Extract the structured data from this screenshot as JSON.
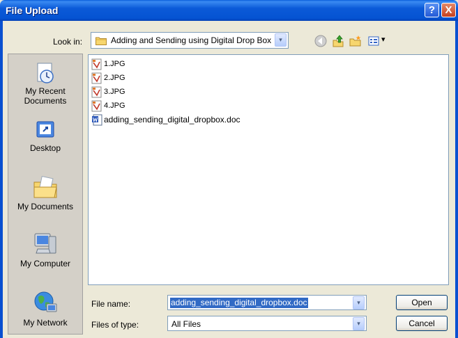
{
  "window": {
    "title": "File Upload",
    "help_label": "?",
    "close_label": "X"
  },
  "lookin": {
    "label": "Look in:",
    "value": "Adding and Sending using Digital Drop Box",
    "dropdown_glyph": "▾"
  },
  "toolbar": {
    "icons": [
      "back-icon",
      "up-one-level-icon",
      "create-new-folder-icon",
      "view-menu-icon"
    ],
    "view_arrow": "▾"
  },
  "places": [
    {
      "label": "My Recent Documents",
      "line1": "My Recent",
      "line2": "Documents",
      "icon": "my-recent-documents-icon"
    },
    {
      "label": "Desktop",
      "icon": "desktop-icon"
    },
    {
      "label": "My Documents",
      "icon": "my-documents-icon"
    },
    {
      "label": "My Computer",
      "icon": "my-computer-icon"
    },
    {
      "label": "My Network",
      "icon": "my-network-icon"
    }
  ],
  "files": [
    {
      "name": "1.JPG",
      "icon": "jpg-file-icon"
    },
    {
      "name": "2.JPG",
      "icon": "jpg-file-icon"
    },
    {
      "name": "3.JPG",
      "icon": "jpg-file-icon"
    },
    {
      "name": "4.JPG",
      "icon": "jpg-file-icon"
    },
    {
      "name": "adding_sending_digital_dropbox.doc",
      "icon": "word-document-icon"
    }
  ],
  "filename": {
    "label": "File name:",
    "value": "adding_sending_digital_dropbox.doc"
  },
  "filetype": {
    "label": "Files of type:",
    "value": "All Files"
  },
  "buttons": {
    "open": "Open",
    "cancel": "Cancel"
  },
  "colors": {
    "titlebar": "#0553d2",
    "selection": "#316ac5",
    "dialog_bg": "#ece9d8"
  }
}
